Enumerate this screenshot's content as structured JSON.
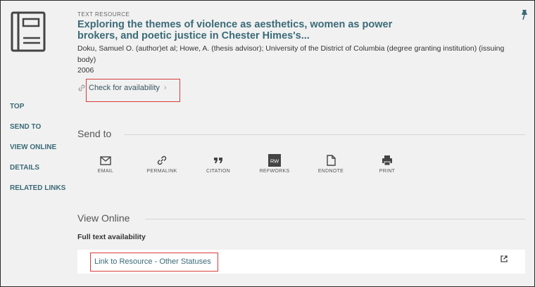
{
  "record": {
    "type_label": "TEXT RESOURCE",
    "title": "Exploring the themes of violence as aesthetics, women as power brokers, and poetic justice in Chester Himes's...",
    "authors": "Doku, Samuel O. (author)et al; Howe, A. (thesis advisor); University of the District of Columbia (degree granting institution) (issuing body)",
    "year": "2006",
    "availability_label": "Check for availability"
  },
  "side_nav": {
    "items": [
      {
        "label": "TOP"
      },
      {
        "label": "SEND TO"
      },
      {
        "label": "VIEW ONLINE"
      },
      {
        "label": "DETAILS"
      },
      {
        "label": "RELATED LINKS"
      }
    ]
  },
  "send_to": {
    "title": "Send to",
    "actions": [
      {
        "label": "EMAIL",
        "icon": "email-icon"
      },
      {
        "label": "PERMALINK",
        "icon": "permalink-icon"
      },
      {
        "label": "CITATION",
        "icon": "citation-icon"
      },
      {
        "label": "REFWORKS",
        "icon": "refworks-icon",
        "badge": "RW"
      },
      {
        "label": "ENDNOTE",
        "icon": "endnote-icon"
      },
      {
        "label": "PRINT",
        "icon": "print-icon"
      }
    ]
  },
  "view_online": {
    "title": "View Online",
    "full_text_label": "Full text availability",
    "resource_link": "Link to Resource - Other Statuses"
  },
  "colors": {
    "background": "#f1f1f1",
    "accent": "#3a6a77",
    "highlight": "#d93b3b"
  }
}
